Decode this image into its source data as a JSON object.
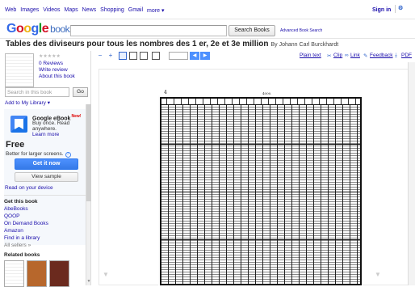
{
  "topbar": {
    "nav": [
      "Web",
      "Images",
      "Videos",
      "Maps",
      "News",
      "Shopping",
      "Gmail",
      "more ▾"
    ],
    "sign_in": "Sign in",
    "options_glyph": "⚙"
  },
  "brand": {
    "logo_g": "G",
    "logo_o1": "o",
    "logo_o2": "o",
    "logo_g2": "g",
    "logo_l": "l",
    "logo_e": "e",
    "logo_books": "books",
    "search_button": "Search Books",
    "advanced": "Advanced Book Search",
    "search_value": ""
  },
  "book": {
    "title": "Tables des diviseurs pour tous les nombres des 1 er, 2e et 3e million",
    "author": "By Johann Carl Burckhardt"
  },
  "sidebar": {
    "reviews": "0 Reviews",
    "write_review": "Write review",
    "about": "About this book",
    "search_in_book_placeholder": "Search in this book",
    "go": "Go",
    "add_library": "Add to My Library ▾",
    "ebook_title": "Google eBook",
    "new_badge": "New!",
    "ebook_line1": "Buy once. Read",
    "ebook_line2": "anywhere.",
    "learn_more": "Learn more",
    "price": "Free",
    "better": "Better for larger screens.",
    "get_it_now": "Get it now",
    "view_sample": "View sample",
    "read_device": "Read on your device",
    "get_this_book": "Get this book",
    "stores": [
      "AbeBooks",
      "QOOP",
      "On Demand Books",
      "Amazon",
      "Find in a library",
      "All sellers »"
    ],
    "related_books": "Related books"
  },
  "toolbar": {
    "zoom_out": "−",
    "zoom_in": "+",
    "page_value": "",
    "prev": "◀",
    "next": "▶",
    "plain_text": "Plain text",
    "clip": "Clip",
    "link": "Link",
    "feedback": "Feedback",
    "pdf": "PDF"
  },
  "document": {
    "page_number": "4",
    "running_head": "4000."
  },
  "colors": {
    "link": "#1a0dab",
    "accent_blue": "#4d90fe",
    "logo_blue": "#3d6dbf"
  }
}
